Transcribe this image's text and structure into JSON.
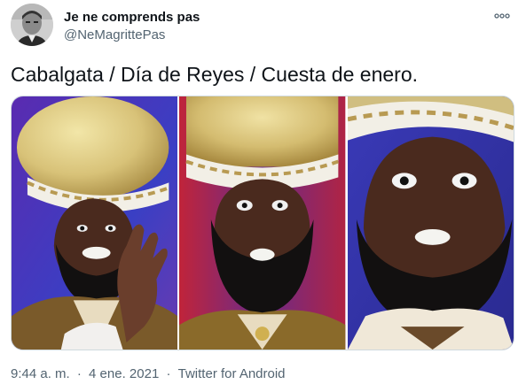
{
  "author": {
    "name": "Je ne comprends pas",
    "handle": "@NeMagrittePas",
    "avatar_icon": "profile-photo"
  },
  "more_icon": "more-options-icon",
  "tweet": {
    "text": "Cabalgata / Día de Reyes / Cuesta de enero."
  },
  "media": {
    "panels": [
      {
        "label": "smiling-waving-king"
      },
      {
        "label": "surprised-king"
      },
      {
        "label": "wide-eyed-king-closeup"
      }
    ]
  },
  "meta": {
    "time": "9:44 a. m.",
    "separator1": "·",
    "date": "4 ene. 2021",
    "separator2": "·",
    "source": "Twitter for Android"
  },
  "colors": {
    "text_primary": "#0f1419",
    "text_secondary": "#536471",
    "border": "#cfd9de"
  }
}
